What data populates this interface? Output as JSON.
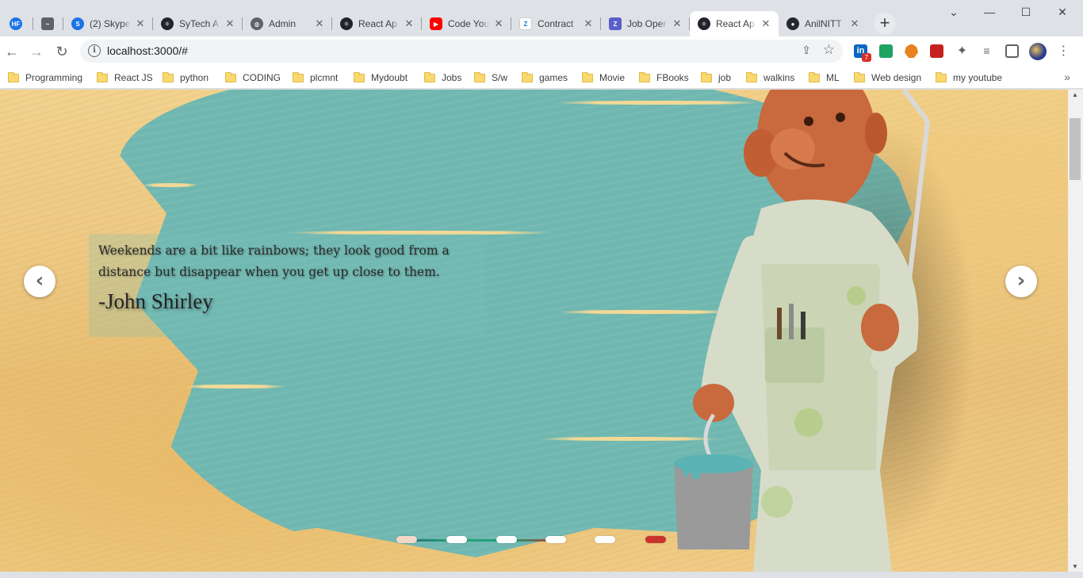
{
  "browser": {
    "tabs": [
      {
        "title": "",
        "icon": "hf-icon",
        "color": "#1a73e8"
      },
      {
        "title": "",
        "icon": "bird-icon",
        "color": "#5f6368"
      },
      {
        "title": "(2) Skype",
        "icon": "skype-icon",
        "color": "#1a73e8"
      },
      {
        "title": "SyTech A",
        "icon": "react-icon",
        "color": "#20232a"
      },
      {
        "title": "Admin",
        "icon": "globe-icon",
        "color": "#5f6368"
      },
      {
        "title": "React Ap",
        "icon": "react-icon",
        "color": "#20232a"
      },
      {
        "title": "Code You",
        "icon": "youtube-icon",
        "color": "#ff0000"
      },
      {
        "title": "Contract",
        "icon": "z-icon",
        "color": "#1a73e8"
      },
      {
        "title": "Job Oper",
        "icon": "zoho-icon",
        "color": "#5b5fc7"
      },
      {
        "title": "React Ap",
        "icon": "react-icon",
        "color": "#20232a"
      },
      {
        "title": "AnilNITT",
        "icon": "github-icon",
        "color": "#24292e"
      }
    ],
    "active_tab_index": 9,
    "url": "localhost:3000/#",
    "extension_badge": "7",
    "bookmarks": [
      "Programming",
      "React JS",
      "python",
      "CODING",
      "plcmnt",
      "Mydoubt",
      "Jobs",
      "S/w",
      "games",
      "Movie",
      "FBooks",
      "job",
      "walkins",
      "ML",
      "Web design",
      "my youtube"
    ]
  },
  "carousel": {
    "quote": "Weekends are a bit like rainbows; they look good from a distance but disappear when you get up close to them.",
    "author": "-John Shirley",
    "prev_icon": "chevron-left-icon",
    "next_icon": "chevron-right-icon",
    "slide_count": 6,
    "active_slide": 5,
    "active_color": "#c8342c"
  }
}
